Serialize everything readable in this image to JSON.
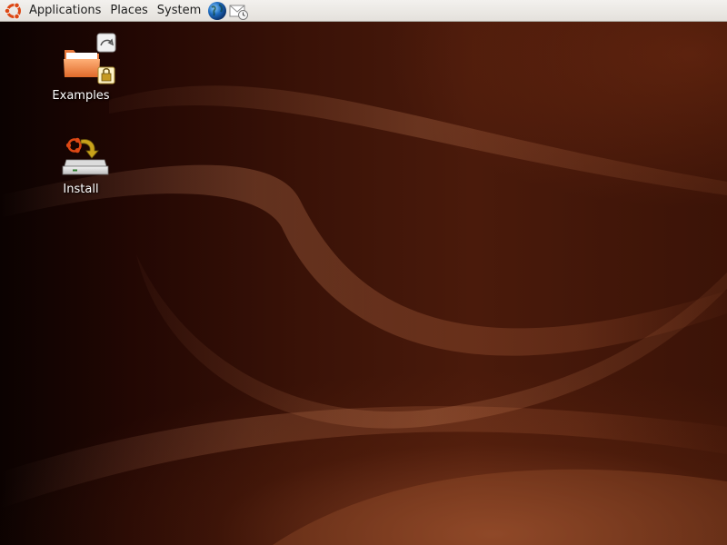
{
  "panel": {
    "menus": {
      "applications": "Applications",
      "places": "Places",
      "system": "System"
    },
    "launchers": [
      "web-browser-icon",
      "email-client-icon"
    ]
  },
  "desktop": {
    "icons": [
      {
        "label": "Examples",
        "icon": "folder-icon"
      },
      {
        "label": "Install",
        "icon": "install-drive-icon"
      }
    ]
  },
  "colors": {
    "panel": "#e9e7e3",
    "wallpaper_dark": "#1a0502",
    "wallpaper_mid": "#4a1a0b",
    "wallpaper_highlight": "#b2623a",
    "folder": "#f08a47"
  }
}
